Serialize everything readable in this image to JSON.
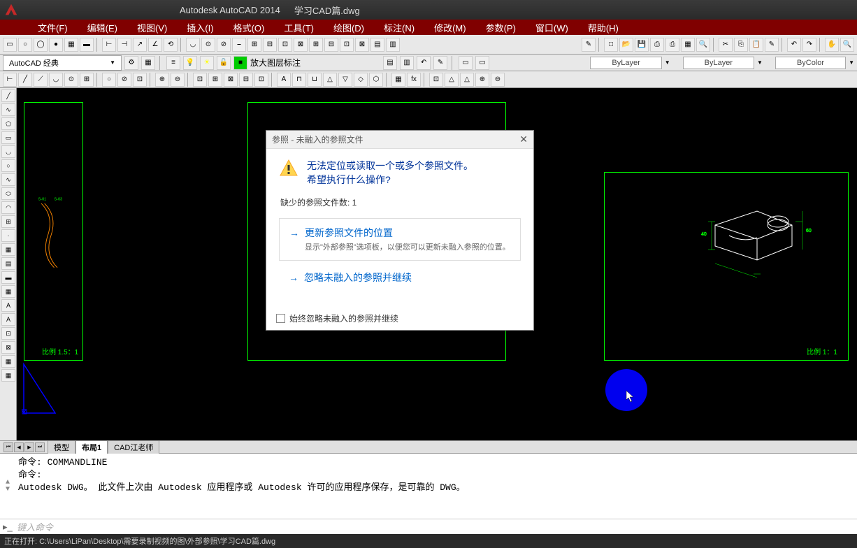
{
  "title": {
    "app": "Autodesk AutoCAD 2014",
    "file": "学习CAD篇.dwg"
  },
  "menus": [
    "文件(F)",
    "编辑(E)",
    "视图(V)",
    "插入(I)",
    "格式(O)",
    "工具(T)",
    "绘图(D)",
    "标注(N)",
    "修改(M)",
    "参数(P)",
    "窗口(W)",
    "帮助(H)"
  ],
  "workspace": {
    "name": "AutoCAD 经典",
    "layer_label": "放大图层标注"
  },
  "properties": {
    "color": "ByLayer",
    "linetype": "ByLayer",
    "lineweight": "ByColor"
  },
  "tabs": {
    "model": "模型",
    "layout1": "布局1",
    "layout2": "CAD江老师"
  },
  "viewports": {
    "scale1": "比例 1.5：1",
    "scale2": "比例 1：1"
  },
  "command": {
    "line1": "命令:   COMMANDLINE",
    "line2": "命令:",
    "line3": "Autodesk DWG。  此文件上次由 Autodesk 应用程序或 Autodesk 许可的应用程序保存，是可靠的 DWG。",
    "placeholder": "键入命令"
  },
  "status": "正在打开: C:\\Users\\LiPan\\Desktop\\需要录制视频的图\\外部参照\\学习CAD篇.dwg",
  "dialog": {
    "title": "参照 - 未融入的参照文件",
    "heading1": "无法定位或读取一个或多个参照文件。",
    "heading2": "希望执行什么操作?",
    "count": "缺少的参照文件数: 1",
    "opt1_title": "更新参照文件的位置",
    "opt1_desc": "显示\"外部参照\"选项板，以便您可以更新未融入参照的位置。",
    "opt2_title": "忽略未融入的参照并继续",
    "footer_chk": "始终忽略未融入的参照并继续"
  }
}
